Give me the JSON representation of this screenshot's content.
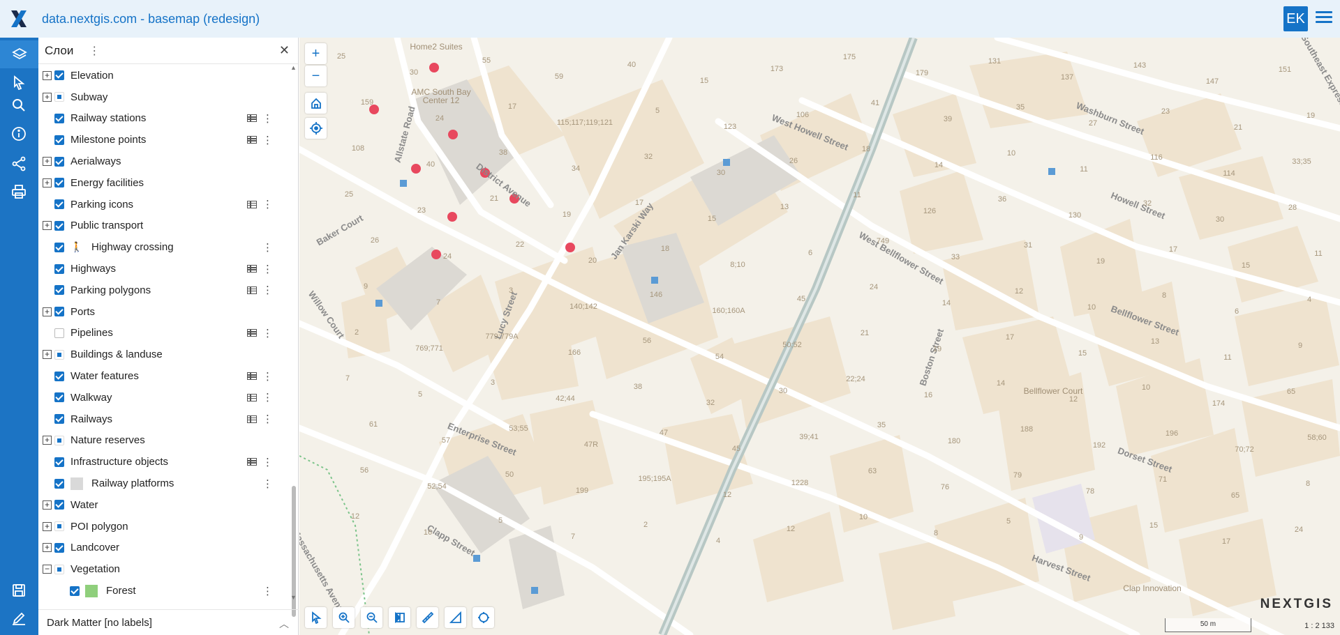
{
  "header": {
    "title": "data.nextgis.com - basemap (redesign)",
    "avatar": "EK"
  },
  "colors": {
    "accent": "#1573c7",
    "sidebar": "#1c74c4",
    "map_bg": "#f4f1e9",
    "road": "#ffffff",
    "building": "#efe3cf",
    "railway": "#b7c7c4",
    "poi": "#e8485e"
  },
  "panel": {
    "title": "Слои",
    "basemap": "Dark Matter [no labels]",
    "layers": [
      {
        "label": "Elevation",
        "expander": "+",
        "check": "on",
        "indent": 0,
        "table": false,
        "menu": false
      },
      {
        "label": "Subway",
        "expander": "+",
        "check": "partial",
        "indent": 0,
        "table": false,
        "menu": false
      },
      {
        "label": "Railway stations",
        "expander": "",
        "check": "on",
        "indent": 1,
        "table": true,
        "menu": true
      },
      {
        "label": "Milestone points",
        "expander": "",
        "check": "on",
        "indent": 1,
        "table": true,
        "menu": true
      },
      {
        "label": "Aerialways",
        "expander": "+",
        "check": "on",
        "indent": 0,
        "table": false,
        "menu": false
      },
      {
        "label": "Energy facilities",
        "expander": "+",
        "check": "on",
        "indent": 0,
        "table": false,
        "menu": false
      },
      {
        "label": "Parking icons",
        "expander": "",
        "check": "on",
        "indent": 1,
        "table": true,
        "menu": true
      },
      {
        "label": "Public transport",
        "expander": "+",
        "check": "on",
        "indent": 0,
        "table": false,
        "menu": false
      },
      {
        "label": "Highway crossing",
        "expander": "",
        "check": "on",
        "indent": 1,
        "table": false,
        "menu": true,
        "icon": "pedestrian"
      },
      {
        "label": "Highways",
        "expander": "",
        "check": "on",
        "indent": 1,
        "table": true,
        "menu": true
      },
      {
        "label": "Parking polygons",
        "expander": "",
        "check": "on",
        "indent": 1,
        "table": true,
        "menu": true
      },
      {
        "label": "Ports",
        "expander": "+",
        "check": "on",
        "indent": 0,
        "table": false,
        "menu": false
      },
      {
        "label": "Pipelines",
        "expander": "",
        "check": "off",
        "indent": 1,
        "table": true,
        "menu": true
      },
      {
        "label": "Buildings & landuse",
        "expander": "+",
        "check": "partial",
        "indent": 0,
        "table": false,
        "menu": false
      },
      {
        "label": "Water features",
        "expander": "",
        "check": "on",
        "indent": 1,
        "table": true,
        "menu": true
      },
      {
        "label": "Walkway",
        "expander": "",
        "check": "on",
        "indent": 1,
        "table": true,
        "menu": true
      },
      {
        "label": "Railways",
        "expander": "",
        "check": "on",
        "indent": 1,
        "table": true,
        "menu": true
      },
      {
        "label": "Nature reserves",
        "expander": "+",
        "check": "partial",
        "indent": 0,
        "table": false,
        "menu": false
      },
      {
        "label": "Infrastructure objects",
        "expander": "",
        "check": "on",
        "indent": 1,
        "table": true,
        "menu": true
      },
      {
        "label": "Railway platforms",
        "expander": "",
        "check": "on",
        "indent": 1,
        "table": false,
        "menu": true,
        "swatch": "#d9d9d9"
      },
      {
        "label": "Water",
        "expander": "+",
        "check": "on",
        "indent": 0,
        "table": false,
        "menu": false
      },
      {
        "label": "POI polygon",
        "expander": "+",
        "check": "partial",
        "indent": 0,
        "table": false,
        "menu": false
      },
      {
        "label": "Landcover",
        "expander": "+",
        "check": "on",
        "indent": 0,
        "table": false,
        "menu": false
      },
      {
        "label": "Vegetation",
        "expander": "−",
        "check": "partial",
        "indent": 0,
        "table": false,
        "menu": false
      },
      {
        "label": "Forest",
        "expander": "",
        "check": "on",
        "indent": 2,
        "table": false,
        "menu": true,
        "swatch": "#8fcf7c"
      }
    ]
  },
  "map": {
    "brand": "NEXTGIS",
    "scale_label": "50 m",
    "scale_ratio": "1 : 2 133",
    "streets": [
      {
        "name": "Allstate Road"
      },
      {
        "name": "District Avenue"
      },
      {
        "name": "Jan Karski Way"
      },
      {
        "name": "West Howell Street"
      },
      {
        "name": "Washburn Street"
      },
      {
        "name": "Howell Street"
      },
      {
        "name": "West Bellflower Street"
      },
      {
        "name": "Bellflower Street"
      },
      {
        "name": "Boston Street"
      },
      {
        "name": "Baker Court"
      },
      {
        "name": "Willow Court"
      },
      {
        "name": "Lucy Street"
      },
      {
        "name": "Enterprise Street"
      },
      {
        "name": "Dorset Street"
      },
      {
        "name": "Clapp Street"
      },
      {
        "name": "Harvest Street"
      },
      {
        "name": "Massachusetts Avenue"
      },
      {
        "name": "Southeast Expressway"
      }
    ],
    "places": [
      {
        "text": "AMC South Bay"
      },
      {
        "text": "Center 12"
      },
      {
        "text": "Home2 Suites"
      },
      {
        "text": "Bellflower Court"
      },
      {
        "text": "Clap Innovation"
      }
    ],
    "numbers": [
      "25",
      "30",
      "55",
      "59",
      "40",
      "15",
      "173",
      "175",
      "179",
      "131",
      "137",
      "143",
      "147",
      "151",
      "159",
      "24",
      "17",
      "115;117;119;121",
      "5",
      "123",
      "106",
      "41",
      "39",
      "35",
      "27",
      "23",
      "21",
      "19",
      "108",
      "40",
      "38",
      "34",
      "32",
      "30",
      "26",
      "18",
      "14",
      "10",
      "11",
      "116",
      "114",
      "33;35",
      "25",
      "23",
      "21",
      "19",
      "17",
      "15",
      "13",
      "11",
      "126",
      "36",
      "130",
      "32",
      "30",
      "28",
      "26",
      "24",
      "22",
      "20",
      "18",
      "8;10",
      "6",
      "749",
      "33",
      "31",
      "19",
      "17",
      "15",
      "11",
      "9",
      "7",
      "3",
      "140;142",
      "146",
      "160;160A",
      "45",
      "24",
      "14",
      "12",
      "10",
      "8",
      "6",
      "4",
      "2",
      "769;771",
      "779;779A",
      "166",
      "56",
      "54",
      "50;52",
      "21",
      "19",
      "17",
      "15",
      "13",
      "11",
      "9",
      "7",
      "5",
      "3",
      "42;44",
      "38",
      "32",
      "30",
      "22;24",
      "16",
      "14",
      "12",
      "10",
      "174",
      "65",
      "61",
      "57",
      "53;55",
      "47R",
      "47",
      "45",
      "39;41",
      "35",
      "180",
      "188",
      "192",
      "196",
      "70;72",
      "58;60",
      "56",
      "52;54",
      "50",
      "199",
      "195;195A",
      "12",
      "1228",
      "63",
      "76",
      "79",
      "78",
      "71",
      "65",
      "8",
      "12",
      "16",
      "5",
      "7",
      "2",
      "4",
      "12",
      "10",
      "8",
      "5",
      "9",
      "15",
      "17",
      "24"
    ]
  }
}
